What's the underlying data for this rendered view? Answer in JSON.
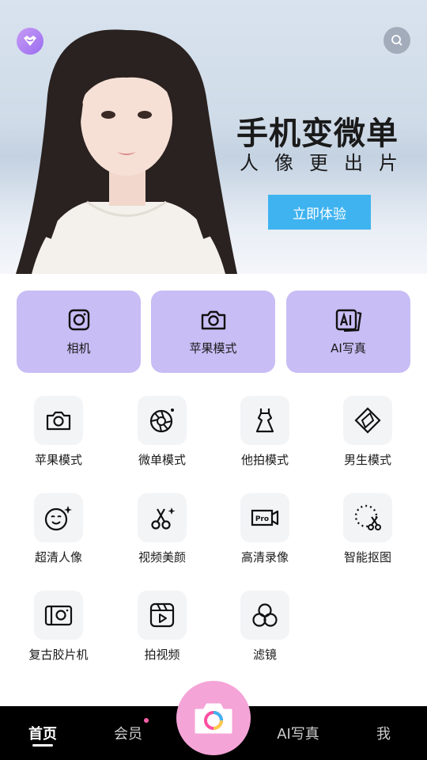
{
  "hero": {
    "title": "手机变微单",
    "subtitle": "人像更出片",
    "cta_label": "立即体验"
  },
  "feature_cards": [
    {
      "label": "相机",
      "icon": "camera-icon"
    },
    {
      "label": "苹果模式",
      "icon": "camera-icon"
    },
    {
      "label": "AI写真",
      "icon": "ai-photo-icon"
    }
  ],
  "modes": [
    {
      "label": "苹果模式",
      "icon": "camera-icon"
    },
    {
      "label": "微单模式",
      "icon": "aperture-icon"
    },
    {
      "label": "他拍模式",
      "icon": "dress-icon"
    },
    {
      "label": "男生模式",
      "icon": "diamond-icon"
    },
    {
      "label": "超清人像",
      "icon": "face-sparkle-icon"
    },
    {
      "label": "视频美颜",
      "icon": "scissors-icon"
    },
    {
      "label": "高清录像",
      "icon": "pro-video-icon"
    },
    {
      "label": "智能抠图",
      "icon": "cutout-icon"
    },
    {
      "label": "复古胶片机",
      "icon": "film-camera-icon"
    },
    {
      "label": "拍视频",
      "icon": "clapper-icon"
    },
    {
      "label": "滤镜",
      "icon": "filter-icon"
    }
  ],
  "tabbar": {
    "home": "首页",
    "vip": "会员",
    "ai_photo": "AI写真",
    "me": "我",
    "active": "home"
  },
  "colors": {
    "card_bg": "#c8bdf5",
    "cta_bg": "#3fb3f0",
    "shutter_bg": "#f5a4d7",
    "badge_dot": "#ff5fa8"
  }
}
